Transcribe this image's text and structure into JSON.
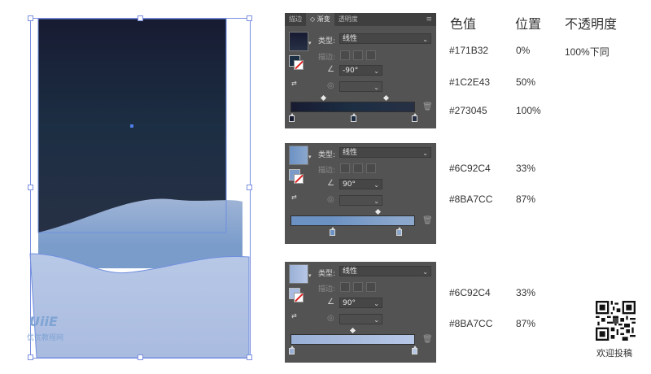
{
  "artboard": {
    "top_gradient": [
      "#171B32",
      "#1C2E43",
      "#273045"
    ],
    "wave_gradient": [
      "#6C92C4",
      "#8BA7CC"
    ],
    "watermark": {
      "logo": "UiiE",
      "text": "优优教程网"
    }
  },
  "panels": [
    {
      "tabs": [
        "描边",
        "渐变",
        "透明度"
      ],
      "type_label": "类型:",
      "type_value": "线性",
      "stroke_label": "描边:",
      "angle_value": "-90°",
      "stop_colors": [
        "#171B32",
        "#1C2E43",
        "#273045"
      ],
      "stop_positions_pct": [
        0,
        50,
        100
      ]
    },
    {
      "type_label": "类型:",
      "type_value": "线性",
      "stroke_label": "描边:",
      "angle_value": "90°",
      "stop_colors": [
        "#6C92C4",
        "#8BA7CC"
      ],
      "stop_positions_pct": [
        33,
        87
      ]
    },
    {
      "type_label": "类型:",
      "type_value": "线性",
      "stroke_label": "描边:",
      "angle_value": "90°",
      "stop_colors": [
        "#6C92C4",
        "#8BA7CC"
      ],
      "stop_positions_pct": [
        0,
        100
      ]
    }
  ],
  "info": {
    "headers": {
      "color": "色值",
      "position": "位置",
      "opacity": "不透明度"
    },
    "group1": [
      {
        "color": "#171B32",
        "position": "0%",
        "opacity": "100%下同"
      },
      {
        "color": "#1C2E43",
        "position": "50%"
      },
      {
        "color": "#273045",
        "position": "100%"
      }
    ],
    "group2": [
      {
        "color": "#6C92C4",
        "position": "33%"
      },
      {
        "color": "#8BA7CC",
        "position": "87%"
      }
    ],
    "group3": [
      {
        "color": "#6C92C4",
        "position": "33%"
      },
      {
        "color": "#8BA7CC",
        "position": "87%"
      }
    ]
  },
  "qr_caption": "欢迎投稿"
}
